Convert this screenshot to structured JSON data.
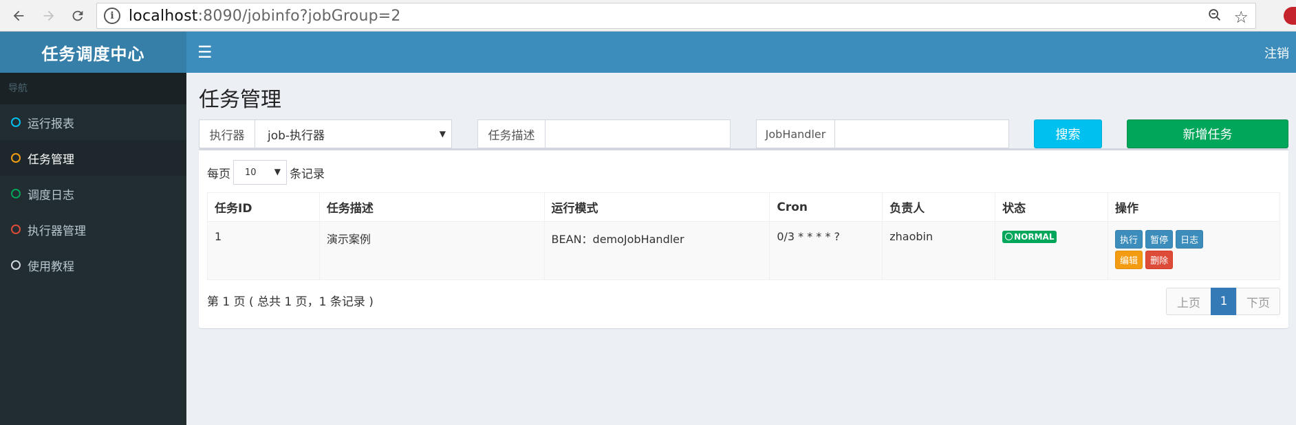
{
  "browser": {
    "url_host": "localhost",
    "url_rest": ":8090/jobinfo?jobGroup=2"
  },
  "header": {
    "logo": "任务调度中心",
    "toggle_icon": "☰",
    "logout": "注销"
  },
  "sidebar": {
    "header": "导航",
    "items": [
      {
        "label": "运行报表",
        "color": "#00c0ef"
      },
      {
        "label": "任务管理",
        "color": "#f39c12"
      },
      {
        "label": "调度日志",
        "color": "#00a65a"
      },
      {
        "label": "执行器管理",
        "color": "#dd4b39"
      },
      {
        "label": "使用教程",
        "color": "#d2d6de"
      }
    ]
  },
  "page": {
    "title": "任务管理"
  },
  "filters": {
    "executor_label": "执行器",
    "executor_value": "job-执行器",
    "desc_label": "任务描述",
    "desc_value": "",
    "handler_label": "JobHandler",
    "handler_value": "",
    "search_button": "搜索",
    "add_button": "新增任务"
  },
  "table": {
    "perpage_prefix": "每页",
    "perpage_value": "10",
    "perpage_suffix": "条记录",
    "columns": [
      "任务ID",
      "任务描述",
      "运行模式",
      "Cron",
      "负责人",
      "状态",
      "操作"
    ],
    "rows": [
      {
        "id": "1",
        "desc": "演示案例",
        "mode": "BEAN：demoJobHandler",
        "cron": "0/3 * * * * ?",
        "author": "zhaobin",
        "status": "NORMAL",
        "ops": [
          "执行",
          "暂停",
          "日志",
          "编辑",
          "删除"
        ]
      }
    ],
    "page_info": "第 1 页 ( 总共 1 页，1 条记录 )",
    "pager": {
      "prev": "上页",
      "current": "1",
      "next": "下页"
    }
  }
}
